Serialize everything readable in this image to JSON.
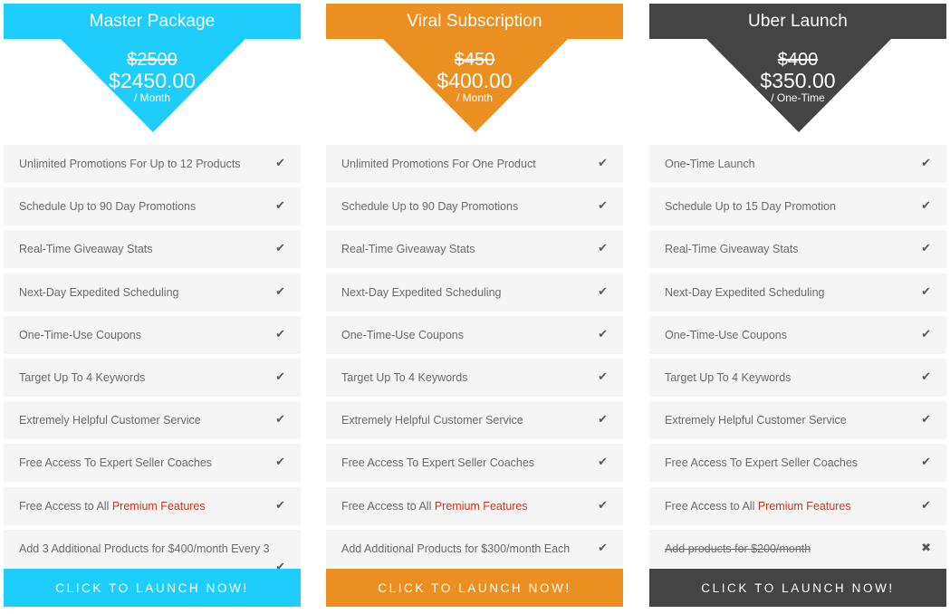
{
  "plans": [
    {
      "title": "Master Package",
      "color": "#1ecdfc",
      "old_price": "$2500",
      "price": "$2450.00",
      "period": "/ Month",
      "features": [
        {
          "text": "Unlimited Promotions For Up to 12 Products",
          "included": true,
          "icon": "check-icon"
        },
        {
          "text": "Schedule Up to 90 Day Promotions",
          "included": true,
          "icon": "check-icon"
        },
        {
          "text": "Real-Time Giveaway Stats",
          "included": true,
          "icon": "check-icon"
        },
        {
          "text": "Next-Day Expedited Scheduling",
          "included": true,
          "icon": "check-icon"
        },
        {
          "text": "One-Time-Use Coupons",
          "included": true,
          "icon": "check-icon"
        },
        {
          "text": "Target Up To 4 Keywords",
          "included": true,
          "icon": "check-icon"
        },
        {
          "text": "Extremely Helpful Customer Service",
          "included": true,
          "icon": "check-icon"
        },
        {
          "text": "Free Access To Expert Seller Coaches",
          "included": true,
          "icon": "check-icon"
        },
        {
          "text": "Free Access to All ",
          "highlight": "Premium Features",
          "included": true,
          "icon": "check-icon"
        },
        {
          "text": "Add 3 Additional Products for $400/month Every 3",
          "included": true,
          "icon": "check-icon"
        }
      ],
      "cta": "CLICK TO LAUNCH NOW!"
    },
    {
      "title": "Viral Subscription",
      "color": "#ec8f21",
      "old_price": "$450",
      "price": "$400.00",
      "period": "/ Month",
      "features": [
        {
          "text": "Unlimited Promotions For One Product",
          "included": true,
          "icon": "check-icon"
        },
        {
          "text": "Schedule Up to 90 Day Promotions",
          "included": true,
          "icon": "check-icon"
        },
        {
          "text": "Real-Time Giveaway Stats",
          "included": true,
          "icon": "check-icon"
        },
        {
          "text": "Next-Day Expedited Scheduling",
          "included": true,
          "icon": "check-icon"
        },
        {
          "text": "One-Time-Use Coupons",
          "included": true,
          "icon": "check-icon"
        },
        {
          "text": "Target Up To 4 Keywords",
          "included": true,
          "icon": "check-icon"
        },
        {
          "text": "Extremely Helpful Customer Service",
          "included": true,
          "icon": "check-icon"
        },
        {
          "text": "Free Access To Expert Seller Coaches",
          "included": true,
          "icon": "check-icon"
        },
        {
          "text": "Free Access to All ",
          "highlight": "Premium Features",
          "included": true,
          "icon": "check-icon"
        },
        {
          "text": "Add Additional Products for $300/month Each",
          "included": true,
          "icon": "check-icon"
        }
      ],
      "cta": "CLICK TO LAUNCH NOW!"
    },
    {
      "title": "Uber Launch",
      "color": "#444444",
      "old_price": "$400",
      "price": "$350.00",
      "period": "/ One-Time",
      "features": [
        {
          "text": "One-Time Launch",
          "included": true,
          "icon": "check-icon"
        },
        {
          "text": "Schedule Up to 15 Day Promotion",
          "included": true,
          "icon": "check-icon"
        },
        {
          "text": "Real-Time Giveaway Stats",
          "included": true,
          "icon": "check-icon"
        },
        {
          "text": "Next-Day Expedited Scheduling",
          "included": true,
          "icon": "check-icon"
        },
        {
          "text": "One-Time-Use Coupons",
          "included": true,
          "icon": "check-icon"
        },
        {
          "text": "Target Up To 4 Keywords",
          "included": true,
          "icon": "check-icon"
        },
        {
          "text": "Extremely Helpful Customer Service",
          "included": true,
          "icon": "check-icon"
        },
        {
          "text": "Free Access To Expert Seller Coaches",
          "included": true,
          "icon": "check-icon"
        },
        {
          "text": "Free Access to All ",
          "highlight": "Premium Features",
          "included": true,
          "icon": "check-icon"
        },
        {
          "text": "Add products for $200/month",
          "included": false,
          "icon": "x-icon"
        }
      ],
      "cta": "CLICK TO LAUNCH NOW!"
    }
  ],
  "icons": {
    "check-icon": "✔",
    "x-icon": "✖"
  },
  "highlight_color": "#c0392b"
}
